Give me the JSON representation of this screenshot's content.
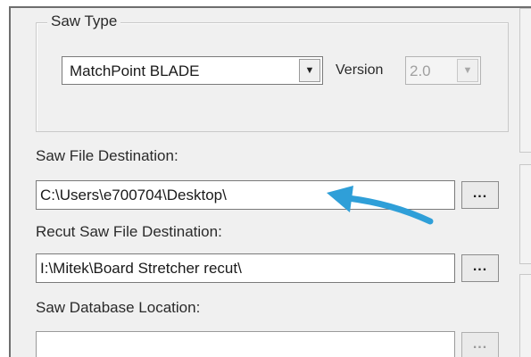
{
  "saw_type_group": {
    "title": "Saw Type",
    "saw_type_select": {
      "value": "MatchPoint BLADE"
    },
    "version_label": "Version",
    "version_select": {
      "value": "2.0",
      "enabled": false
    }
  },
  "saw_file_destination": {
    "label": "Saw File Destination:",
    "value": "C:\\Users\\e700704\\Desktop\\",
    "browse_label": "..."
  },
  "recut_saw_file_destination": {
    "label": "Recut Saw File Destination:",
    "value": "I:\\Mitek\\Board Stretcher recut\\",
    "browse_label": "..."
  },
  "saw_database_location": {
    "label": "Saw Database Location:",
    "value": "",
    "browse_label": "..."
  },
  "annotation": {
    "arrow_color": "#2f9fd8"
  }
}
